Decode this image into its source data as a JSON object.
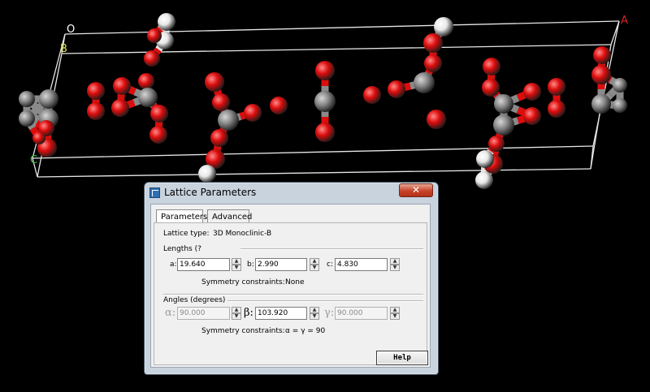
{
  "scene": {
    "axis_labels": {
      "origin": "O",
      "a": "A",
      "b": "B",
      "c": "C"
    },
    "atom_colors": {
      "carbon": "#8a8a8a",
      "oxygen": "#dd0d0d",
      "hydrogen": "#e8e8e8"
    },
    "cell_color": "#e6e6e6",
    "axis_colors": {
      "origin": "#ffffff",
      "a": "#dd2222",
      "b": "#e6e64a",
      "c": "#44bb44"
    }
  },
  "dialog": {
    "title": "Lattice Parameters",
    "close_label": "✕",
    "tabs": [
      {
        "label": "Parameters",
        "active": true
      },
      {
        "label": "Advanced",
        "active": false
      }
    ],
    "lattice_type_label": "Lattice type:",
    "lattice_type_value": "3D Monoclinic-B",
    "lengths_label": "Lengths (?",
    "a_label": "a:",
    "a_value": "19.640",
    "b_label": "b:",
    "b_value": "2.990",
    "c_label": "c:",
    "c_value": "4.830",
    "lengths_symmetry_label": "Symmetry constraints:",
    "lengths_symmetry_value": "None",
    "angles_label": "Angles (degrees)",
    "alpha_label": "α:",
    "alpha_value": "90.000",
    "beta_label": "β:",
    "beta_value": "103.920",
    "gamma_label": "γ:",
    "gamma_value": "90.000",
    "angles_symmetry_label": "Symmetry constraints:",
    "angles_symmetry_value": "α = γ = 90",
    "help_label": "Help"
  }
}
